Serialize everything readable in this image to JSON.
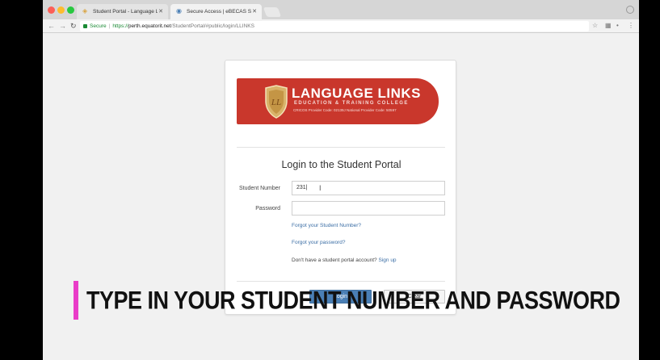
{
  "browser": {
    "tabs": [
      {
        "label": "Student Portal - Language Li",
        "active": false,
        "icon": "shield-favicon"
      },
      {
        "label": "Secure Access | eBECAS Stu",
        "active": true,
        "icon": "ebecas-favicon"
      }
    ],
    "address": {
      "secure_label": "Secure",
      "url_protocol": "https://",
      "url_host": "perth.equatorit.net",
      "url_path": "/StudentPortal/#public/login/LLINKS"
    }
  },
  "logo": {
    "title": "LANGUAGE LINKS",
    "subtitle": "EDUCATION & TRAINING COLLEGE",
    "codes": "CRICOS Provider Code: 02139J   National Provider Code: 50597"
  },
  "login": {
    "heading": "Login to the Student Portal",
    "student_number_label": "Student Number",
    "student_number_value": "231|",
    "password_label": "Password",
    "password_value": "",
    "forgot_number_link": "Forgot your Student Number?",
    "forgot_password_link": "Forgot your password?",
    "no_account_text": "Don't have a student portal account?",
    "signup_link": "Sign up",
    "login_button": "Login",
    "clear_button": "Clear"
  },
  "caption": {
    "text": "TYPE IN YOUR STUDENT NUMBER AND  PASSWORD",
    "accent_color": "#e93dc8"
  },
  "colors": {
    "brand_red": "#c9372c",
    "primary_button": "#4a7fb5",
    "link": "#3b6ea5"
  }
}
